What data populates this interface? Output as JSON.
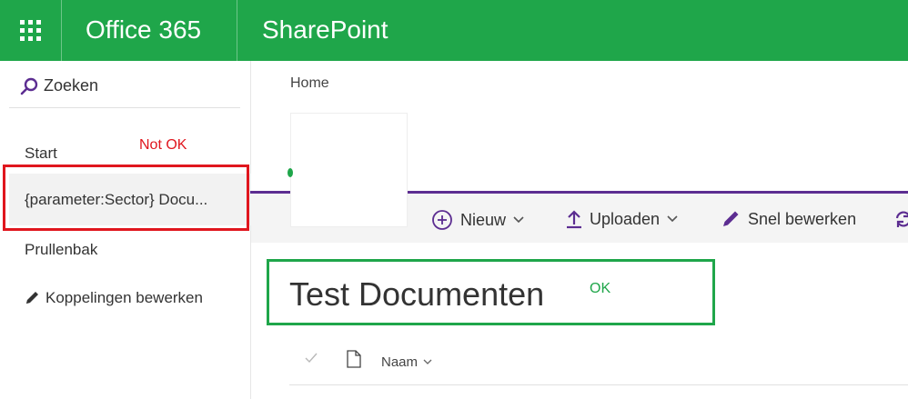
{
  "suite_bar": {
    "app_name": "Office 365",
    "site_name": "SharePoint",
    "color": "#1fa64a",
    "icon": "app-launcher-waffle-icon"
  },
  "left_nav": {
    "search_label": "Zoeken",
    "items": [
      {
        "label": "Start"
      },
      {
        "label": "{parameter:Sector} Docu..."
      },
      {
        "label": "Prullenbak"
      },
      {
        "label": "Koppelingen bewerken"
      }
    ]
  },
  "annotations": {
    "not_ok": "Not OK",
    "ok": "OK",
    "red": "#e0161e",
    "green": "#1fa64a"
  },
  "breadcrumb": "Home",
  "command_bar": {
    "new_label": "Nieuw",
    "upload_label": "Uploaden",
    "quick_edit_label": "Snel bewerken"
  },
  "page_title": "Test Documenten",
  "list": {
    "name_column": "Naam"
  }
}
